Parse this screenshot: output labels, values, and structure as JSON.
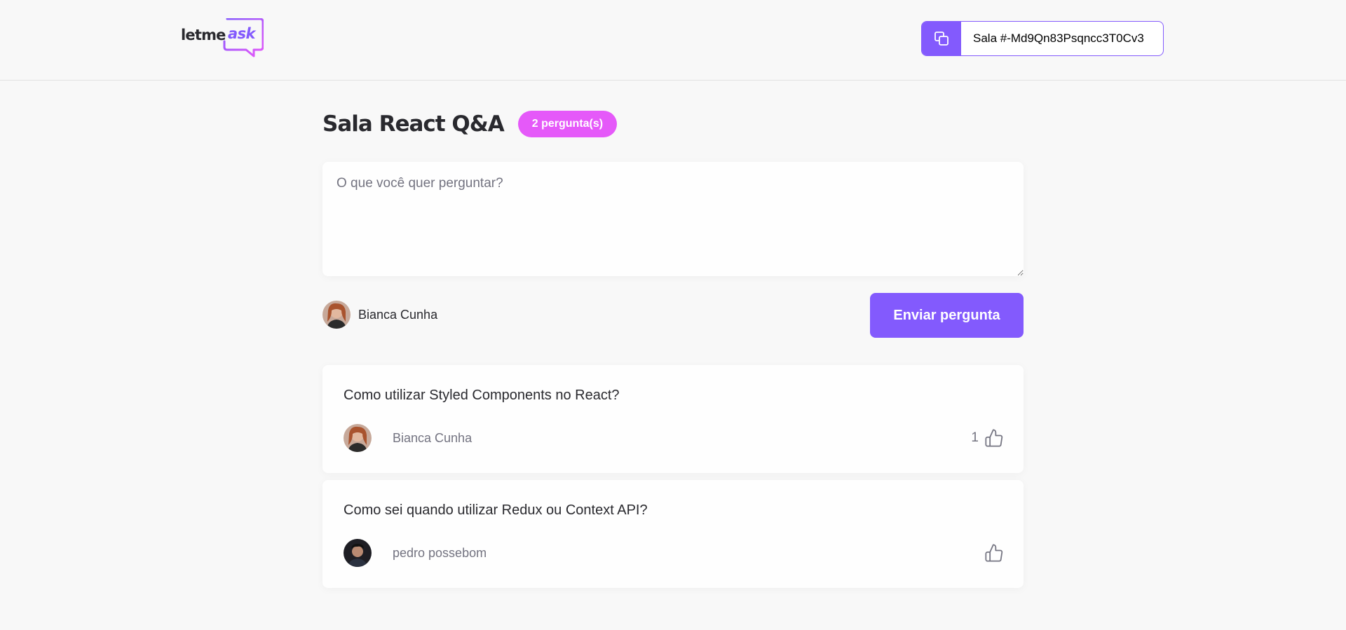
{
  "header": {
    "logo": {
      "part1": "letme",
      "part2": "ask"
    },
    "room_code": {
      "prefix": "Sala ",
      "code": "#-Md9Qn83Psqncc3T0Cv3"
    }
  },
  "room": {
    "title": "Sala React Q&A",
    "count_label": "2 pergunta(s)"
  },
  "form": {
    "placeholder": "O que você quer perguntar?",
    "user_name": "Bianca Cunha",
    "send_label": "Enviar pergunta"
  },
  "questions": [
    {
      "content": "Como utilizar Styled Components no React?",
      "author": "Bianca Cunha",
      "like_count": "1"
    },
    {
      "content": "Como sei quando utilizar Redux ou Context API?",
      "author": "pedro possebom",
      "like_count": ""
    }
  ],
  "colors": {
    "accent": "#835afd",
    "badge": "#e559f9",
    "background": "#f8f8f8"
  },
  "icons": {
    "copy": "copy-icon",
    "like": "thumbs-up-icon"
  }
}
